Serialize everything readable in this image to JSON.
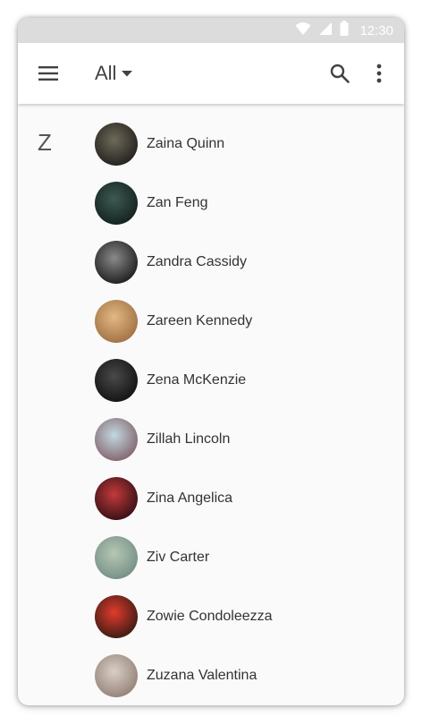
{
  "status_bar": {
    "time": "12:30"
  },
  "app_bar": {
    "filter_label": "All"
  },
  "section": {
    "letter": "Z"
  },
  "contacts": [
    {
      "name": "Zaina Quinn",
      "avatar_colors": [
        "#6e6a5a",
        "#1c1a18"
      ]
    },
    {
      "name": "Zan Feng",
      "avatar_colors": [
        "#3e5a52",
        "#0f1c1a"
      ]
    },
    {
      "name": "Zandra Cassidy",
      "avatar_colors": [
        "#8a8a8a",
        "#141414"
      ]
    },
    {
      "name": "Zareen Kennedy",
      "avatar_colors": [
        "#e3b883",
        "#9a6a3e"
      ]
    },
    {
      "name": "Zena McKenzie",
      "avatar_colors": [
        "#4a4a4a",
        "#0d0d0d"
      ]
    },
    {
      "name": "Zillah Lincoln",
      "avatar_colors": [
        "#c2d8e0",
        "#7d5a62"
      ]
    },
    {
      "name": "Zina Angelica",
      "avatar_colors": [
        "#c23a3a",
        "#2a0c12"
      ]
    },
    {
      "name": "Ziv Carter",
      "avatar_colors": [
        "#b6c7b4",
        "#6f8a82"
      ]
    },
    {
      "name": "Zowie Condoleezza",
      "avatar_colors": [
        "#e23b2c",
        "#2b1812"
      ]
    },
    {
      "name": "Zuzana Valentina",
      "avatar_colors": [
        "#d9cfc7",
        "#8e7a6e"
      ]
    }
  ],
  "colors": {
    "status_bar_bg": "#dcdcdc",
    "app_bar_bg": "#ffffff",
    "list_bg": "#fafafa",
    "text_primary": "#333333",
    "icon": "#424242"
  },
  "icons": {
    "menu": "menu-icon",
    "dropdown": "arrow-drop-down-icon",
    "search": "search-icon",
    "more": "more-vert-icon",
    "wifi": "wifi-icon",
    "signal": "signal-icon",
    "battery": "battery-icon"
  }
}
